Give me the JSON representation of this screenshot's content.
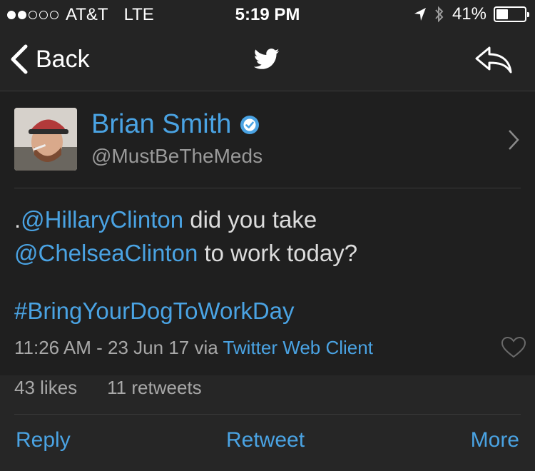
{
  "status_bar": {
    "carrier": "AT&T",
    "network": "LTE",
    "time": "5:19 PM",
    "battery": "41%",
    "battery_level": 0.41,
    "signal_bars_filled": 2,
    "signal_bars_total": 5
  },
  "nav": {
    "back_label": "Back",
    "center_icon": "twitter-bird-icon",
    "right_icon": "reply-arrow-icon"
  },
  "tweet": {
    "author_name": "Brian Smith",
    "author_handle": "@MustBeTheMeds",
    "verified": true,
    "text_prefix": ".",
    "mention1": "@HillaryClinton",
    "text_mid1": " did you take",
    "mention2": "@ChelseaClinton",
    "text_mid2": " to work today?",
    "hashtag": "#BringYourDogToWorkDay",
    "timestamp": "11:26 AM - 23 Jun 17 via ",
    "client": "Twitter Web Client",
    "likes": "43 likes",
    "retweets": "11 retweets"
  },
  "actions": {
    "reply": "Reply",
    "retweet": "Retweet",
    "more": "More"
  },
  "colors": {
    "accent": "#4aa3e3",
    "background": "#1f1f1f",
    "bar": "#242424",
    "muted_text": "#a8a8a8"
  }
}
